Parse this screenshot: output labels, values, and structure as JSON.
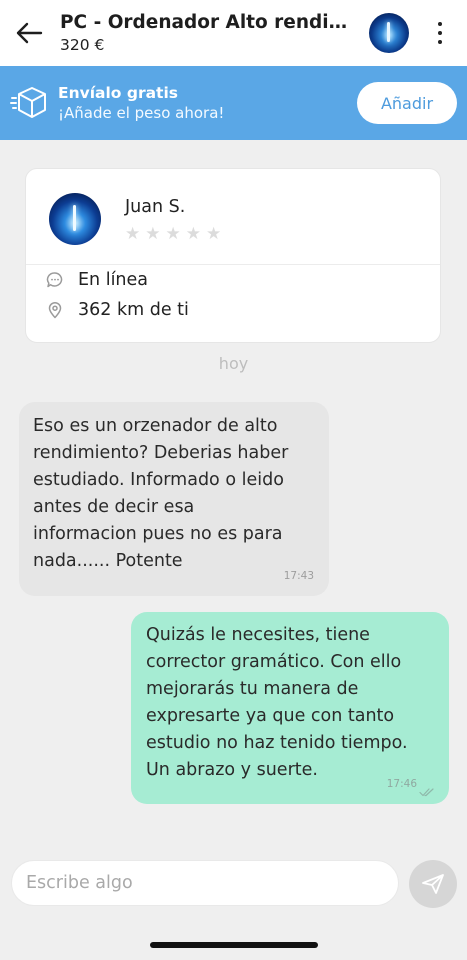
{
  "header": {
    "title": "PC - Ordenador Alto rendimiento",
    "price": "320 €"
  },
  "shipping_banner": {
    "title": "Envíalo gratis",
    "subtitle": "¡Añade el peso ahora!",
    "add_label": "Añadir"
  },
  "profile": {
    "name": "Juan S.",
    "rating_stars": 0,
    "rating_max": 5,
    "status": "En línea",
    "distance": "362 km de ti"
  },
  "chat": {
    "date_label": "hoy",
    "messages": [
      {
        "direction": "incoming",
        "text": "Eso es un orzenador de alto\nrendimiento? Deberias haber\nestudiado. Informado o leido\nantes de decir esa\ninformacion pues no es para\nnada...... Potente",
        "time": "17:43"
      },
      {
        "direction": "outgoing",
        "text": "Quizás le necesites, tiene\ncorrector gramático. Con ello\nmejorarás tu manera de\nexpresarte ya que con tanto\nestudio no haz tenido tiempo.\nUn abrazo y suerte.",
        "time": "17:46"
      }
    ]
  },
  "composer": {
    "placeholder": "Escribe algo",
    "value": ""
  },
  "colors": {
    "banner": "#5aa7e6",
    "outgoing_bubble": "#a6ecd3",
    "incoming_bubble": "#e6e6e6",
    "send_button": "#d6d6d6"
  },
  "icons": {
    "back": "arrow-left-icon",
    "more": "more-vertical-icon",
    "shipping": "package-icon",
    "status": "chat-bubble-icon",
    "location": "location-pin-icon",
    "star": "star-icon",
    "read": "double-check-icon",
    "send": "send-icon"
  }
}
